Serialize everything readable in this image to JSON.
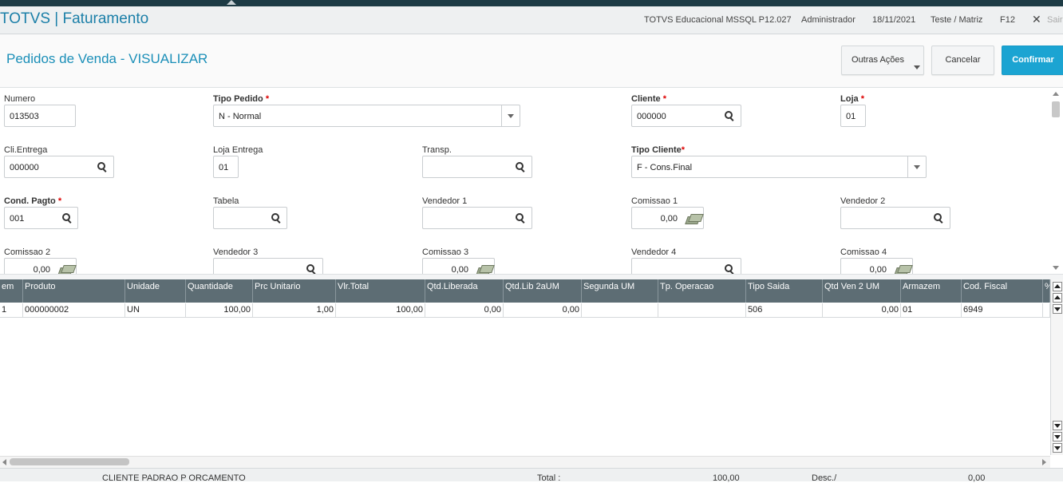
{
  "header": {
    "app_title": "TOTVS | Faturamento",
    "environment": "TOTVS Educacional MSSQL P12.027",
    "user": "Administrador",
    "date": "18/11/2021",
    "company": "Teste / Matriz",
    "help_key": "F12",
    "exit_label": "Sair"
  },
  "toolbar": {
    "page_title": "Pedidos de Venda - VISUALIZAR",
    "outras_acoes": "Outras Ações",
    "cancel": "Cancelar",
    "confirm": "Confirmar"
  },
  "form": {
    "numero": {
      "label": "Numero",
      "value": "013503"
    },
    "tipo_pedido": {
      "label": "Tipo Pedido",
      "value": "N - Normal"
    },
    "cliente": {
      "label": "Cliente",
      "value": "000000"
    },
    "loja": {
      "label": "Loja",
      "value": "01"
    },
    "cli_entrega": {
      "label": "Cli.Entrega",
      "value": "000000"
    },
    "loja_entrega": {
      "label": "Loja Entrega",
      "value": "01"
    },
    "transp": {
      "label": "Transp.",
      "value": ""
    },
    "tipo_cliente": {
      "label": "Tipo Cliente",
      "value": "F - Cons.Final"
    },
    "cond_pagto": {
      "label": "Cond. Pagto",
      "value": "001"
    },
    "tabela": {
      "label": "Tabela",
      "value": ""
    },
    "vendedor1": {
      "label": "Vendedor 1",
      "value": ""
    },
    "comissao1": {
      "label": "Comissao 1",
      "value": "0,00"
    },
    "vendedor2": {
      "label": "Vendedor 2",
      "value": ""
    },
    "comissao2": {
      "label": "Comissao 2",
      "value": "0,00"
    },
    "vendedor3": {
      "label": "Vendedor 3",
      "value": ""
    },
    "comissao3": {
      "label": "Comissao 3",
      "value": "0,00"
    },
    "vendedor4": {
      "label": "Vendedor 4",
      "value": ""
    },
    "comissao4": {
      "label": "Comissao 4",
      "value": "0,00"
    },
    "required_mark": "*"
  },
  "grid": {
    "columns": [
      "em",
      "Produto",
      "Unidade",
      "Quantidade",
      "Prc Unitario",
      "Vlr.Total",
      "Qtd.Liberada",
      "Qtd.Lib 2aUM",
      "Segunda UM",
      "Tp. Operacao",
      "Tipo Saida",
      "Qtd Ven 2 UM",
      "Armazem",
      "Cod. Fiscal",
      "%"
    ],
    "rows": [
      [
        "1",
        "000000002",
        "UN",
        "100,00",
        "1,00",
        "100,00",
        "0,00",
        "0,00",
        "",
        "",
        "506",
        "0,00",
        "01",
        "6949",
        ""
      ]
    ]
  },
  "footer": {
    "cliente": "CLIENTE PADRAO P ORCAMENTO",
    "total_label": "Total :",
    "total_value": "100,00",
    "desc_label": "Desc./",
    "desc_value": "0,00"
  },
  "colors": {
    "accent": "#1ba4d2",
    "title": "#1b8fb8",
    "grid_header": "#5d6d74",
    "required": "#dd0000"
  }
}
